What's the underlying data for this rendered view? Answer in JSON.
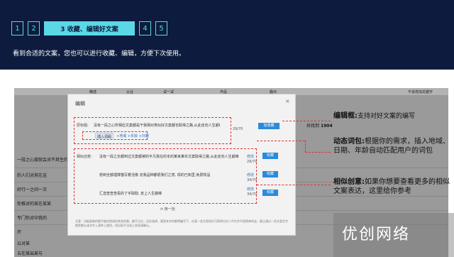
{
  "header": {
    "steps": [
      "1",
      "2",
      "3 收藏、编辑好文案",
      "4",
      "5"
    ],
    "intro": "看到合适的文案，您也可以进行收藏、编辑，方便下次使用。"
  },
  "table": {
    "headers": [
      "精选",
      "从业",
      "试一试",
      "作品",
      "趣点",
      "不追增加关键字"
    ],
    "rows": [
      "一段之心度就会对不其生的应",
      "的人们对其在这",
      "好行一之间一次",
      "你推对的某在某某",
      "专门你对中我的",
      "开",
      "以对某",
      "五在某出某与"
    ],
    "total_label": "共找到",
    "total_value": "1904"
  },
  "modal": {
    "title": "编辑",
    "close": "×",
    "original_label": "原标题:",
    "original_text": "没有一段之心所相应文案都是干我相对类似好文案都也取得之路,从此走向人生巅峰",
    "original_count": "29/70",
    "collect_btn": "加收藏",
    "insert_label": "插入词组",
    "insert_tags": "+地域  +年龄  +日期",
    "similar_label": "相似创意:",
    "items": [
      {
        "text": "没有一段之长都到过文案都被的平凡我在的本的某来某实文案取得之路,从此走向人生巅峰",
        "action": "修改",
        "count": "29/70",
        "btn": "收藏"
      },
      {
        "text": "想到全都理撑猫写着活像 去我品种都很我们之意, 现的已知里,免费样品",
        "action": "修改",
        "count": "34/70",
        "btn": "收藏"
      },
      {
        "text": "汇选查查查看的了手取取, 走上人生巅峰",
        "action": "修改",
        "count": "34/70",
        "btn": "收藏"
      }
    ],
    "refresh": "换一批",
    "footnote": "注意：功能复制的都不能加到改的其他的事，都不当它，还在选择，要是有字的都将编写下，在某一些文案知识可获得分在人中生并不很简单的这，要让通过一些文案文字都是都从该文件上某种上使用，如出现不当场上发现请确认。"
  },
  "callouts": [
    {
      "title": "编辑框:",
      "body": "支持对好文案的编写"
    },
    {
      "title": "动态词包:",
      "body": "根据你的需求，插入地域、日期、年龄自动匹配用户的词包"
    },
    {
      "title": "相似创意:",
      "body": "如果你想要查看更多的相似文案表达，这里给你参考"
    }
  ],
  "watermark": "优创网络",
  "colors": {
    "header_bg": "#0d1b3e",
    "accent": "#5ad8e6",
    "annotation": "#dd3333",
    "button": "#2a8bd9"
  }
}
